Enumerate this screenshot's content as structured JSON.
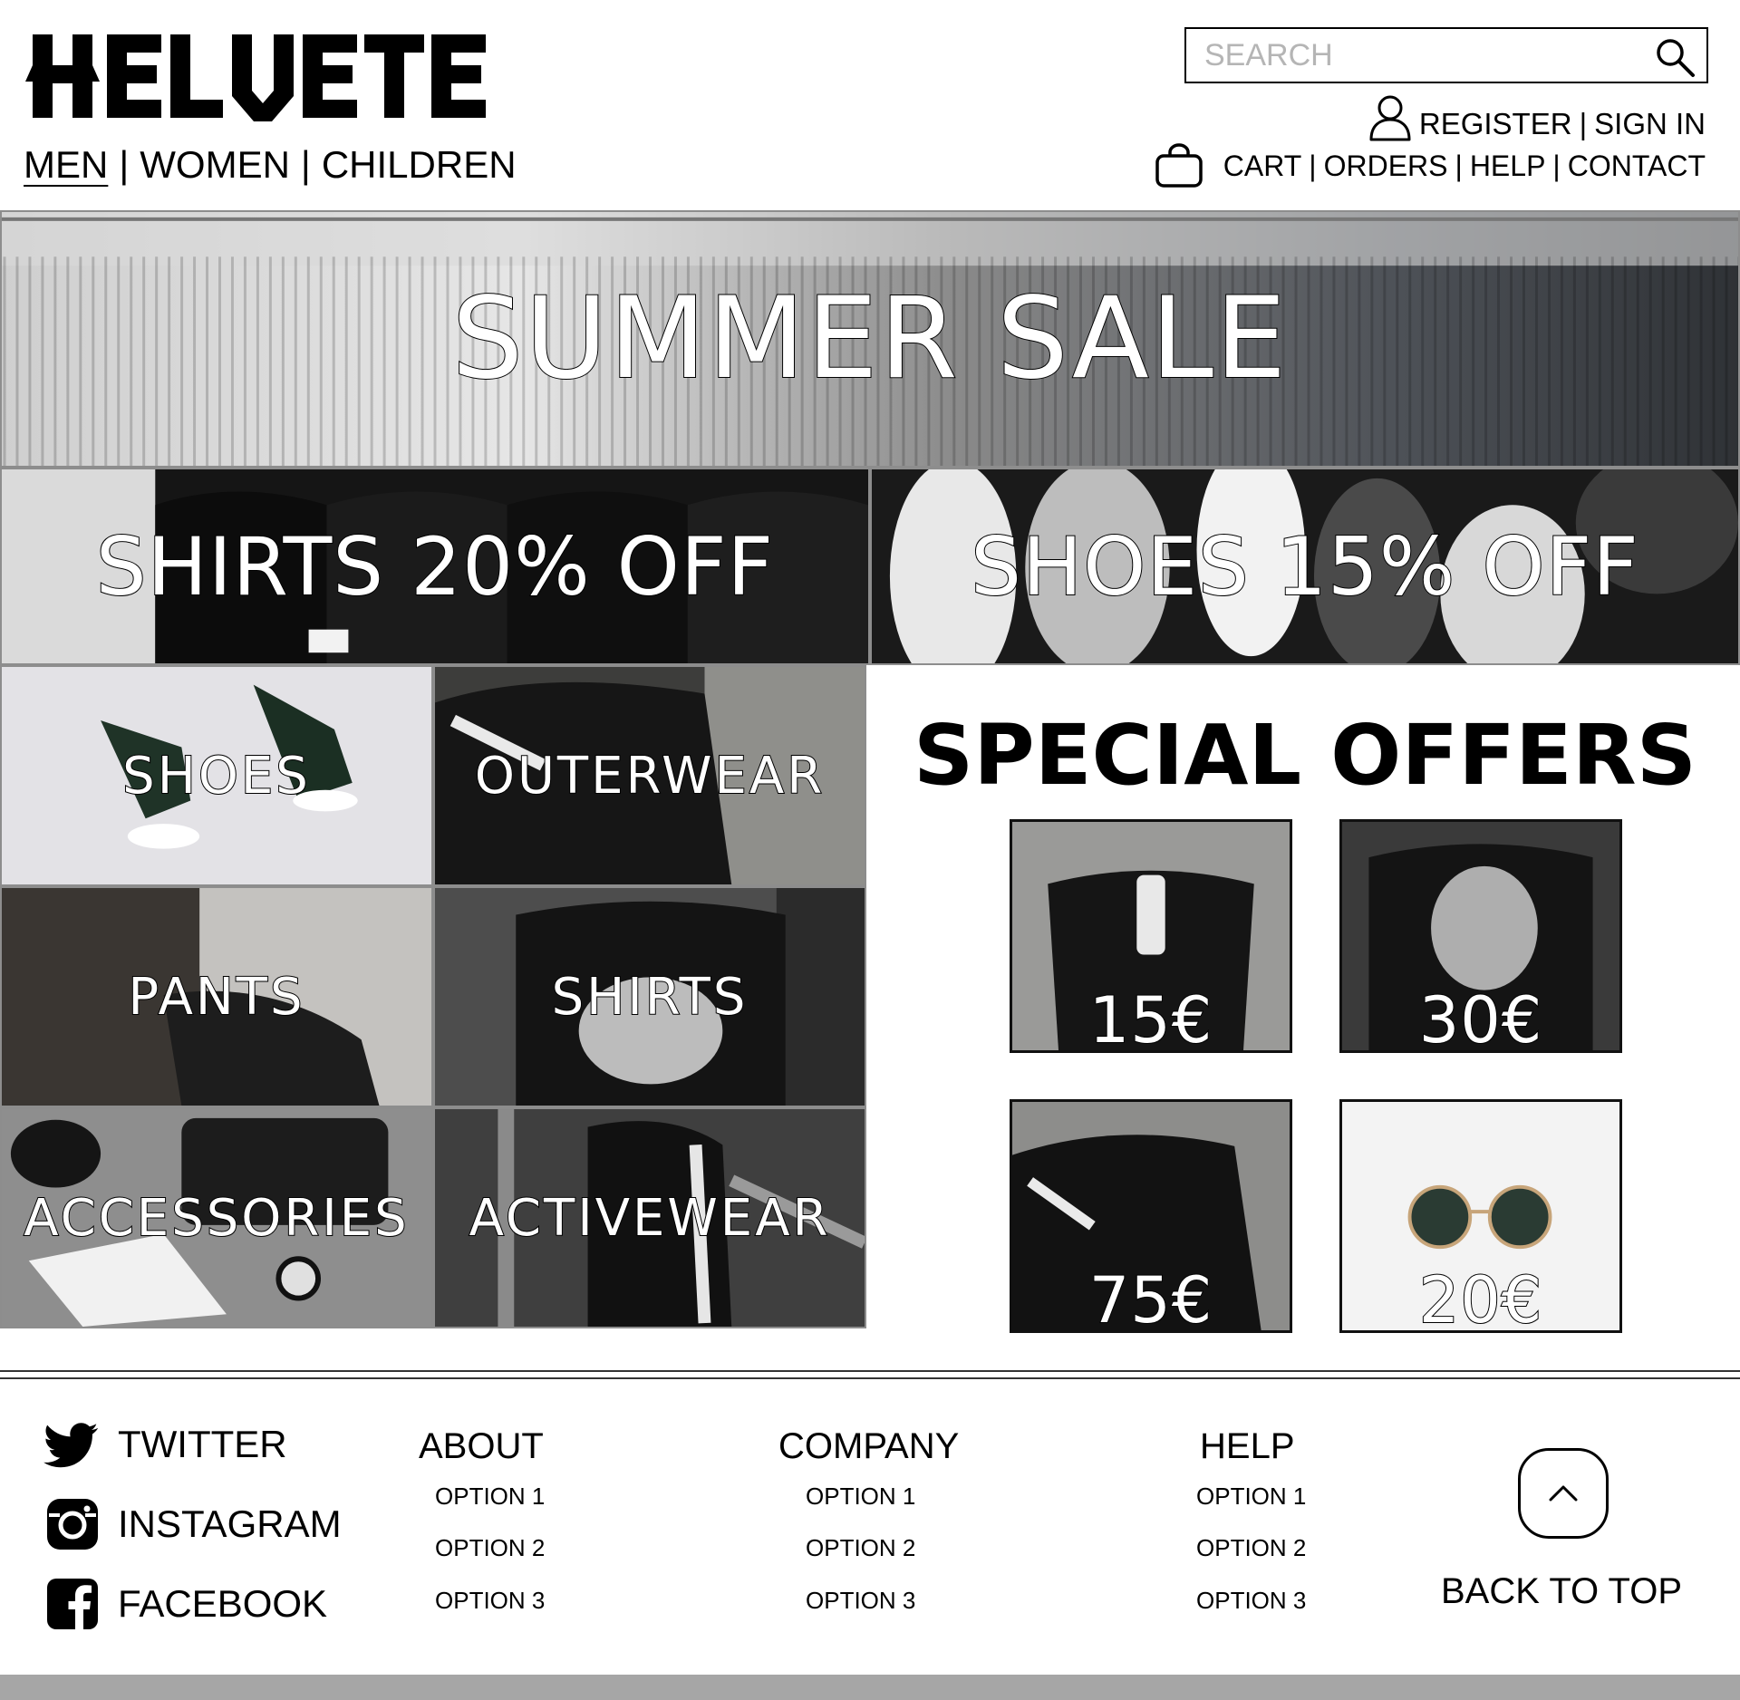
{
  "header": {
    "logo": "HELVETE",
    "nav": [
      {
        "label": "MEN",
        "active": true
      },
      {
        "label": "WOMEN",
        "active": false
      },
      {
        "label": "CHILDREN",
        "active": false
      }
    ],
    "nav_separator": "|",
    "search": {
      "placeholder": "SEARCH",
      "icon": "magnifier-icon"
    },
    "account": {
      "icon": "user-icon",
      "register": "REGISTER",
      "sign_in": "SIGN IN"
    },
    "utility": {
      "icon": "shopping-bag-icon",
      "cart": "CART",
      "orders": "ORDERS",
      "help": "HELP",
      "contact": "CONTACT"
    }
  },
  "hero": {
    "title": "SUMMER SALE"
  },
  "promos": [
    {
      "label": "SHIRTS 20% OFF"
    },
    {
      "label": "SHOES 15% OFF"
    }
  ],
  "categories": [
    {
      "label": "SHOES"
    },
    {
      "label": "OUTERWEAR"
    },
    {
      "label": "PANTS"
    },
    {
      "label": "SHIRTS"
    },
    {
      "label": "ACCESSORIES"
    },
    {
      "label": "ACTIVEWEAR"
    }
  ],
  "special_offers": {
    "title": "SPECIAL OFFERS",
    "items": [
      {
        "price": "15€"
      },
      {
        "price": "30€"
      },
      {
        "price": "75€"
      },
      {
        "price": "20€"
      }
    ]
  },
  "footer": {
    "social": [
      {
        "label": "TWITTER",
        "icon": "twitter-icon"
      },
      {
        "label": "INSTAGRAM",
        "icon": "instagram-icon"
      },
      {
        "label": "FACEBOOK",
        "icon": "facebook-icon"
      }
    ],
    "columns": [
      {
        "title": "ABOUT",
        "options": [
          "OPTION 1",
          "OPTION 2",
          "OPTION 3"
        ]
      },
      {
        "title": "COMPANY",
        "options": [
          "OPTION 1",
          "OPTION 2",
          "OPTION 3"
        ]
      },
      {
        "title": "HELP",
        "options": [
          "OPTION 1",
          "OPTION 2",
          "OPTION 3"
        ]
      }
    ],
    "back_to_top": "BACK TO TOP"
  },
  "colors": {
    "text": "#000000",
    "border": "#8d8d8d",
    "bottom_bar": "#a6a6a6",
    "placeholder": "#b5b5b5"
  }
}
